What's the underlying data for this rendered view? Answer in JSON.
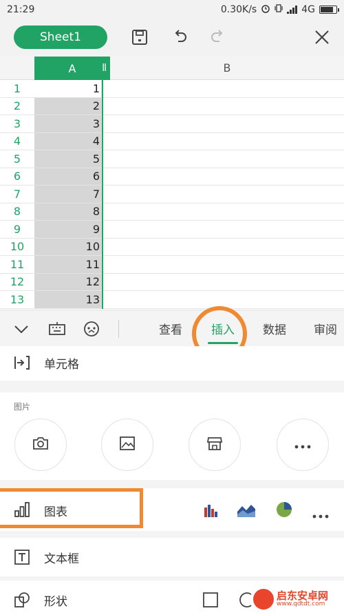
{
  "status_bar": {
    "time": "21:29",
    "network_speed": "0.30K/s",
    "network_type": "4G",
    "icons": [
      "alarm-icon",
      "vibrate-icon",
      "signal-icon",
      "battery-icon"
    ]
  },
  "toolbar": {
    "sheet_tab": "Sheet1",
    "icons": [
      "save-icon",
      "undo-icon",
      "redo-icon",
      "close-icon"
    ]
  },
  "grid": {
    "columns": [
      "A",
      "B"
    ],
    "rows": [
      {
        "num": "1",
        "a": "1"
      },
      {
        "num": "2",
        "a": "2"
      },
      {
        "num": "3",
        "a": "3"
      },
      {
        "num": "4",
        "a": "4"
      },
      {
        "num": "5",
        "a": "5"
      },
      {
        "num": "6",
        "a": "6"
      },
      {
        "num": "7",
        "a": "7"
      },
      {
        "num": "8",
        "a": "8"
      },
      {
        "num": "9",
        "a": "9"
      },
      {
        "num": "10",
        "a": "10"
      },
      {
        "num": "11",
        "a": "11"
      },
      {
        "num": "12",
        "a": "12"
      },
      {
        "num": "13",
        "a": "13"
      }
    ]
  },
  "ribbon": {
    "icons": [
      "collapse-icon",
      "keyboard-icon",
      "assistant-icon"
    ],
    "tabs": [
      "查看",
      "插入",
      "数据",
      "审阅"
    ],
    "active_tab": "插入"
  },
  "panel": {
    "cell_label": "单元格",
    "picture_title": "图片",
    "picture_buttons": [
      "camera-icon",
      "image-icon",
      "store-icon",
      "more-icon"
    ],
    "chart_label": "图表",
    "chart_icons": [
      "bar-chart-icon",
      "area-chart-icon",
      "pie-chart-icon",
      "more-icon"
    ],
    "textbox_label": "文本框",
    "shape_label": "形状"
  },
  "watermark": {
    "title": "启东安卓网",
    "url": "www.qdtdt.com"
  },
  "colors": {
    "accent_green": "#21a366",
    "highlight_orange": "#f08a32",
    "selection_gray": "#d6d6d6"
  }
}
